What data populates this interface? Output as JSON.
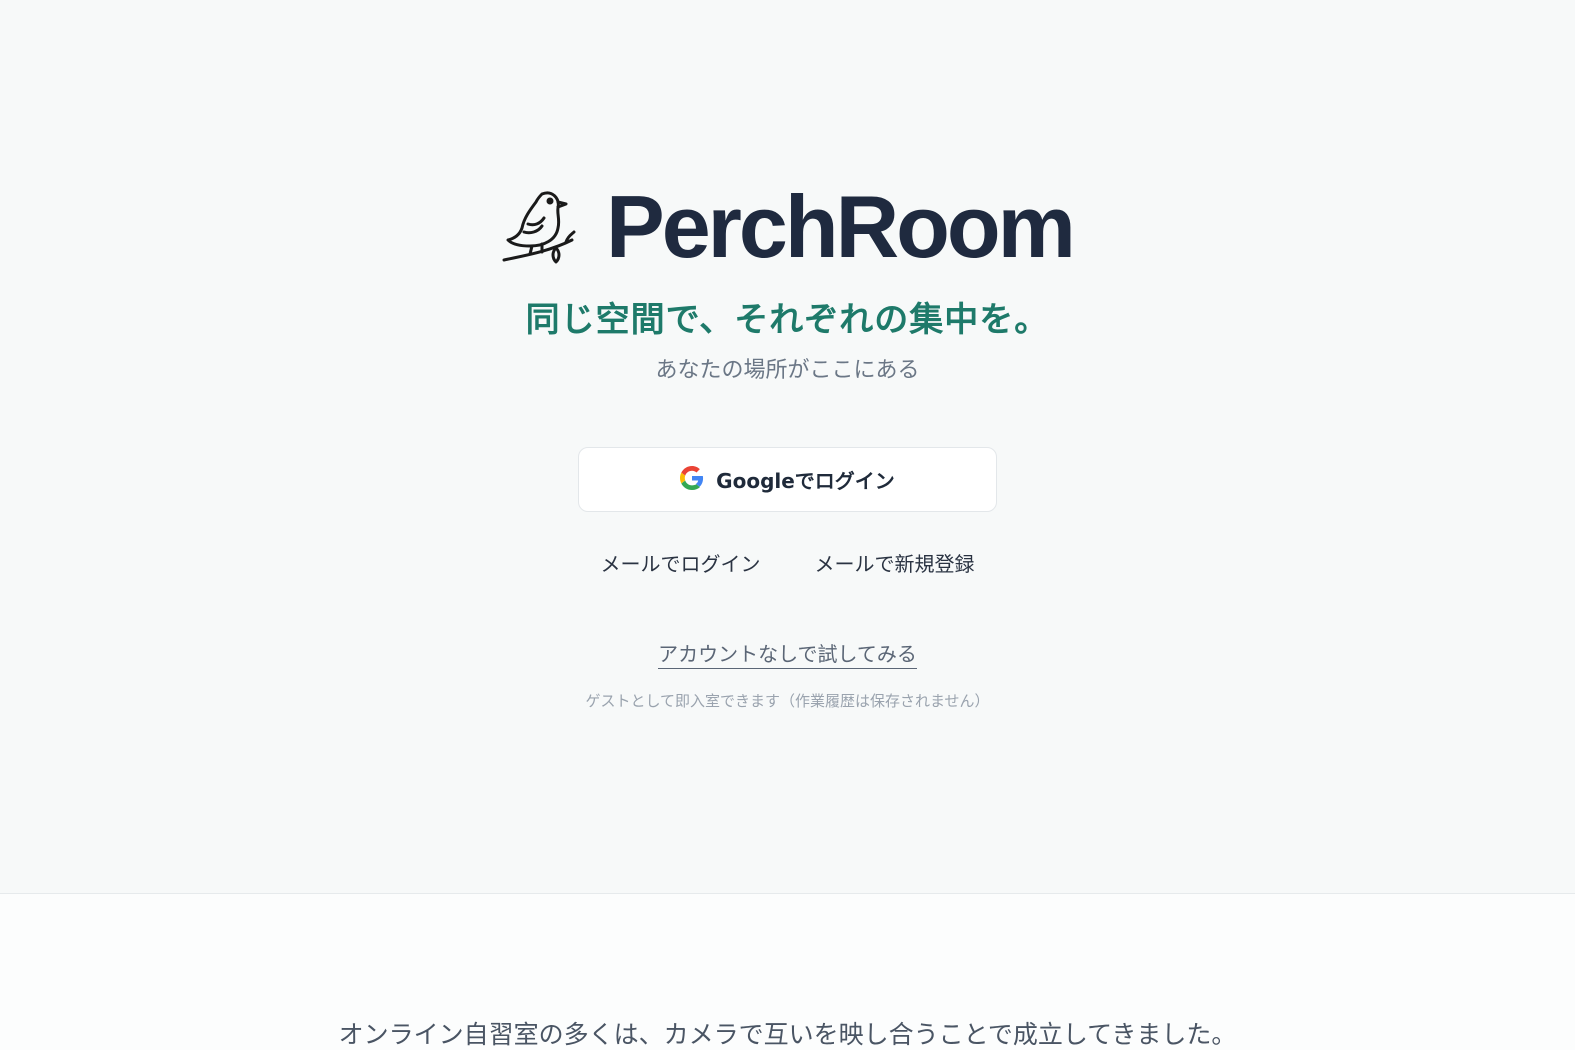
{
  "brand": {
    "name": "PerchRoom",
    "logo_icon": "bird-on-branch-icon",
    "tagline": "同じ空間で、それぞれの集中を。",
    "subtitle": "あなたの場所がここにある"
  },
  "auth": {
    "google_label": "Googleでログイン",
    "google_icon": "google-g-icon",
    "email_login_label": "メールでログイン",
    "email_signup_label": "メールで新規登録",
    "trial_label": "アカウントなしで試してみる",
    "guest_note": "ゲストとして即入室できます（作業履歴は保存されません）"
  },
  "about": {
    "intro": "オンライン自習室の多くは、カメラで互いを映し合うことで成立してきました。"
  },
  "colors": {
    "background": "#f7f9f9",
    "brand_text": "#1f2a3f",
    "accent": "#1e7a6a",
    "muted": "#6b7786"
  }
}
